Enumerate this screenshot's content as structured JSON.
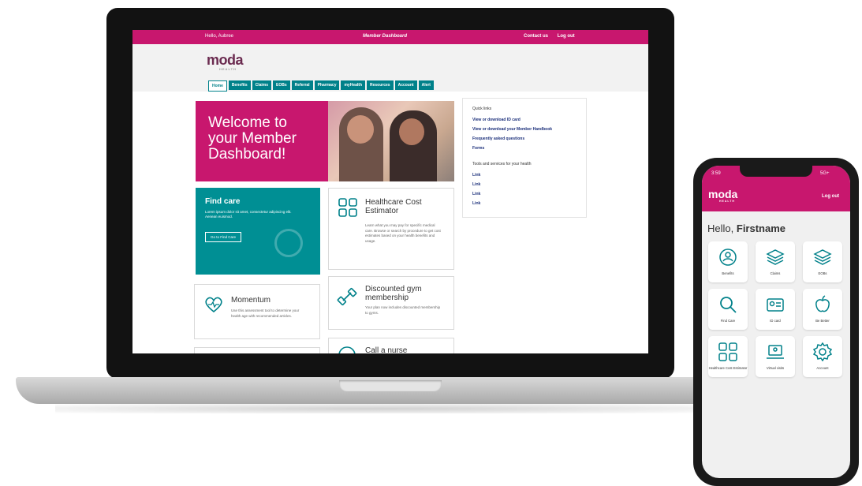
{
  "laptop": {
    "topbar": {
      "greeting": "Hello, Aubree",
      "title": "Member Dashboard",
      "contact": "Contact us",
      "logout": "Log out"
    },
    "logo": {
      "text": "moda",
      "sub": "HEALTH"
    },
    "tabs": [
      "Home",
      "Benefits",
      "Claims",
      "EOBs",
      "Referral",
      "Pharmacy",
      "myHealth",
      "Resources",
      "Account",
      "Alert"
    ],
    "hero": {
      "text": "Welcome to your Member Dashboard!"
    },
    "quick_links": {
      "heading": "Quick links",
      "links": [
        "View or download ID card",
        "View or download your Member Handbook",
        "Frequently asked questions",
        "Forms"
      ],
      "tools_heading": "Tools and services for your health",
      "tools": [
        "Link",
        "Link",
        "Link",
        "Link"
      ]
    },
    "find_care": {
      "title": "Find care",
      "desc": "Lorem ipsum dolor sit amet, consectetur adipiscing elit. Aenean euismod.",
      "button": "Go to Find Care"
    },
    "cost_estimator": {
      "title": "Healthcare Cost Estimator",
      "desc": "Learn what you may pay for specific medical care. Browse or search by procedure to get cost estimates based on your health benefits and usage."
    },
    "momentum": {
      "title": "Momentum",
      "desc": "Use this assessment tool to determine your health age with recommended articles."
    },
    "gym": {
      "title": "Discounted gym membership",
      "desc": "Your plan now includes discounted membership to gyms."
    },
    "nurse": {
      "title": "Call a nurse"
    }
  },
  "phone": {
    "time": "3:59",
    "signal": "5G+",
    "logo": "moda",
    "logo_sub": "HEALTH",
    "logout": "Log out",
    "hello": "Hello,",
    "name": "Firstname",
    "tiles": [
      {
        "label": "Benefits",
        "icon": "benefits-icon"
      },
      {
        "label": "Claims",
        "icon": "claims-icon"
      },
      {
        "label": "EOBs",
        "icon": "eobs-icon"
      },
      {
        "label": "Find Care",
        "icon": "search-icon"
      },
      {
        "label": "ID card",
        "icon": "id-card-icon"
      },
      {
        "label": "Be Better",
        "icon": "apple-icon"
      },
      {
        "label": "Healthcare Cost Estimator",
        "icon": "calculator-icon"
      },
      {
        "label": "Virtual visits",
        "icon": "laptop-icon"
      },
      {
        "label": "Account",
        "icon": "gear-icon"
      }
    ]
  },
  "colors": {
    "brand_pink": "#c8176e",
    "brand_teal": "#008f94",
    "link_blue": "#1b2f7a"
  }
}
